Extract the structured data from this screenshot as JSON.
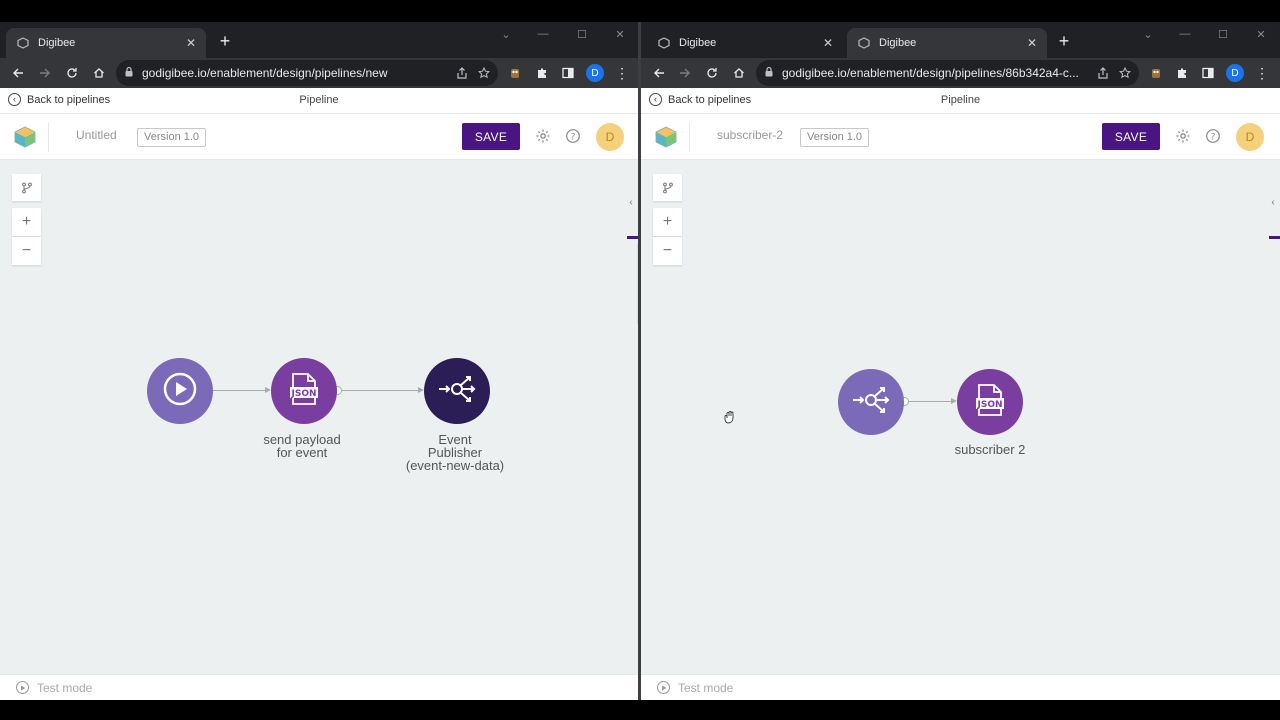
{
  "left": {
    "tab": {
      "title": "Digibee"
    },
    "url": "godigibee.io/enablement/design/pipelines/new",
    "chrome_avatar": "D",
    "appbar": {
      "back_label": "Back to pipelines",
      "title": "Pipeline"
    },
    "header": {
      "pipeline_name": "Untitled",
      "version": "Version 1.0",
      "save_label": "SAVE",
      "user_initial": "D"
    },
    "nodes": [
      {
        "name": "trigger",
        "icon": "play-icon",
        "color": "#7b6ab8",
        "label": ""
      },
      {
        "name": "json-step",
        "icon": "json-icon",
        "color": "#7a3ea0",
        "label": "send payload for event",
        "label_lines": [
          "send payload",
          "for event"
        ]
      },
      {
        "name": "event-publisher",
        "icon": "event-publisher-icon",
        "color": "#2b1e57",
        "label": "Event Publisher (event-new-data)",
        "label_lines": [
          "Event",
          "Publisher",
          "(event-new-data)"
        ]
      }
    ],
    "footer": {
      "test_mode_label": "Test mode"
    }
  },
  "right": {
    "tabs": [
      {
        "title": "Digibee"
      },
      {
        "title": "Digibee"
      }
    ],
    "url": "godigibee.io/enablement/design/pipelines/86b342a4-c...",
    "chrome_avatar": "D",
    "appbar": {
      "back_label": "Back to pipelines",
      "title": "Pipeline"
    },
    "header": {
      "pipeline_name": "subscriber-2",
      "version": "Version 1.0",
      "save_label": "SAVE",
      "user_initial": "D"
    },
    "nodes": [
      {
        "name": "event-trigger",
        "icon": "event-trigger-icon",
        "color": "#7b6ab8",
        "label": ""
      },
      {
        "name": "json-step",
        "icon": "json-icon",
        "color": "#7a3ea0",
        "label": "subscriber 2"
      }
    ],
    "footer": {
      "test_mode_label": "Test mode"
    }
  },
  "colors": {
    "accent": "#4a1481",
    "node_purple": "#7a3ea0",
    "node_lavender": "#7b6ab8",
    "node_dark": "#2b1e57",
    "avatar": "#f6d07a"
  }
}
